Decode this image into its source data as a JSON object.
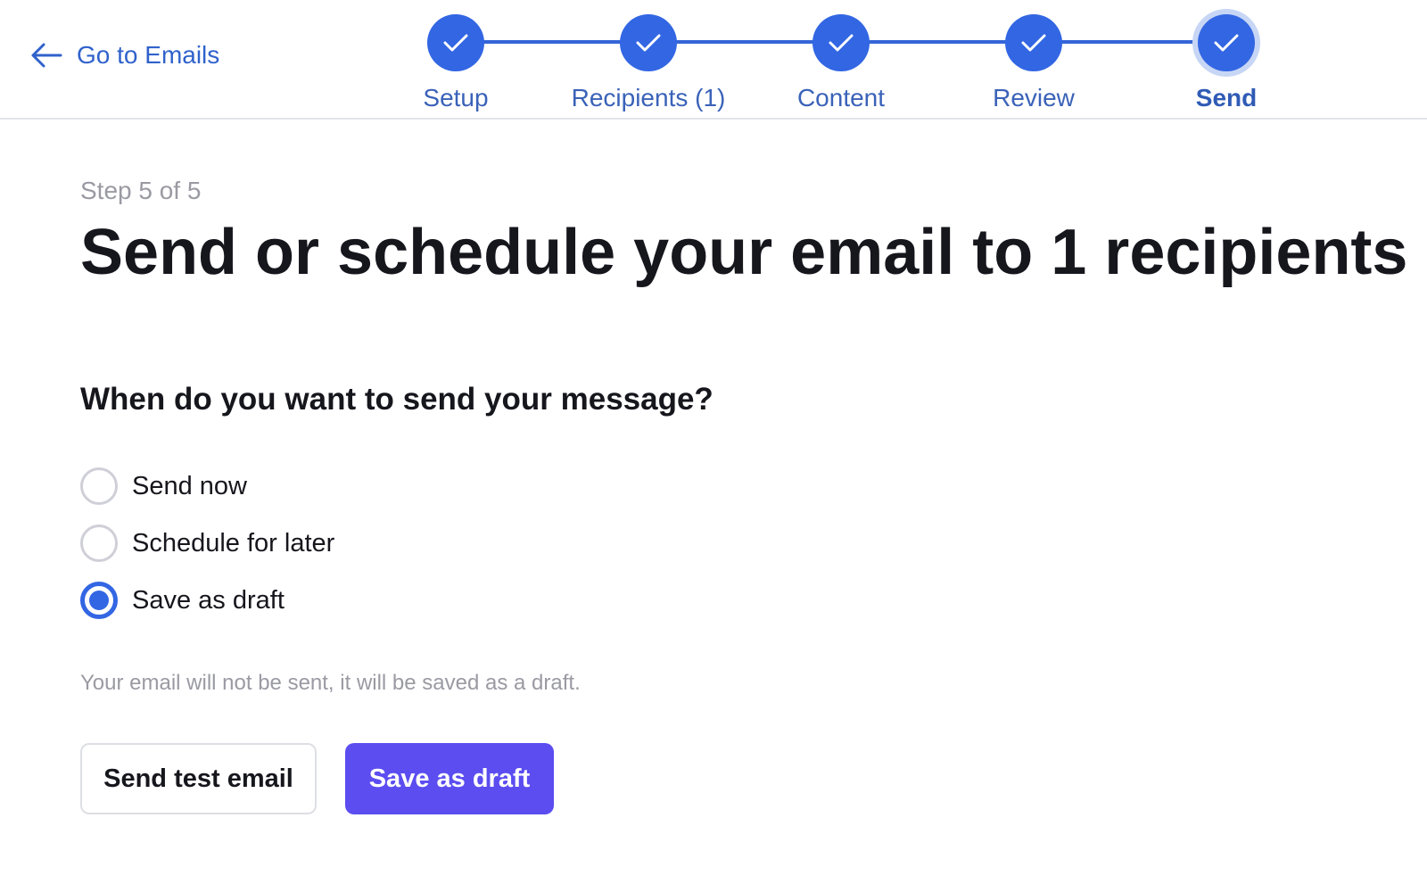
{
  "header": {
    "back_link_label": "Go to Emails",
    "back_icon": "arrow-left-icon"
  },
  "stepper": {
    "steps": [
      {
        "label": "Setup",
        "status": "complete"
      },
      {
        "label": "Recipients (1)",
        "status": "complete"
      },
      {
        "label": "Content",
        "status": "complete"
      },
      {
        "label": "Review",
        "status": "complete"
      },
      {
        "label": "Send",
        "status": "active"
      }
    ],
    "step_icon": "checkmark-icon"
  },
  "main": {
    "step_counter": "Step 5 of 5",
    "title": "Send or schedule your email to 1 recipients",
    "question": "When do you want to send your message?",
    "options": [
      {
        "label": "Send now",
        "checked": false
      },
      {
        "label": "Schedule for later",
        "checked": false
      },
      {
        "label": "Save as draft",
        "checked": true
      }
    ],
    "helper_text": "Your email will not be sent, it will be saved as a draft.",
    "buttons": {
      "secondary_label": "Send test email",
      "primary_label": "Save as draft"
    }
  },
  "colors": {
    "accent_blue": "#3266e3",
    "link_blue": "#3062cc",
    "primary_button": "#5b4df0",
    "muted_text": "#9a9aa3",
    "heading_text": "#16161d"
  }
}
